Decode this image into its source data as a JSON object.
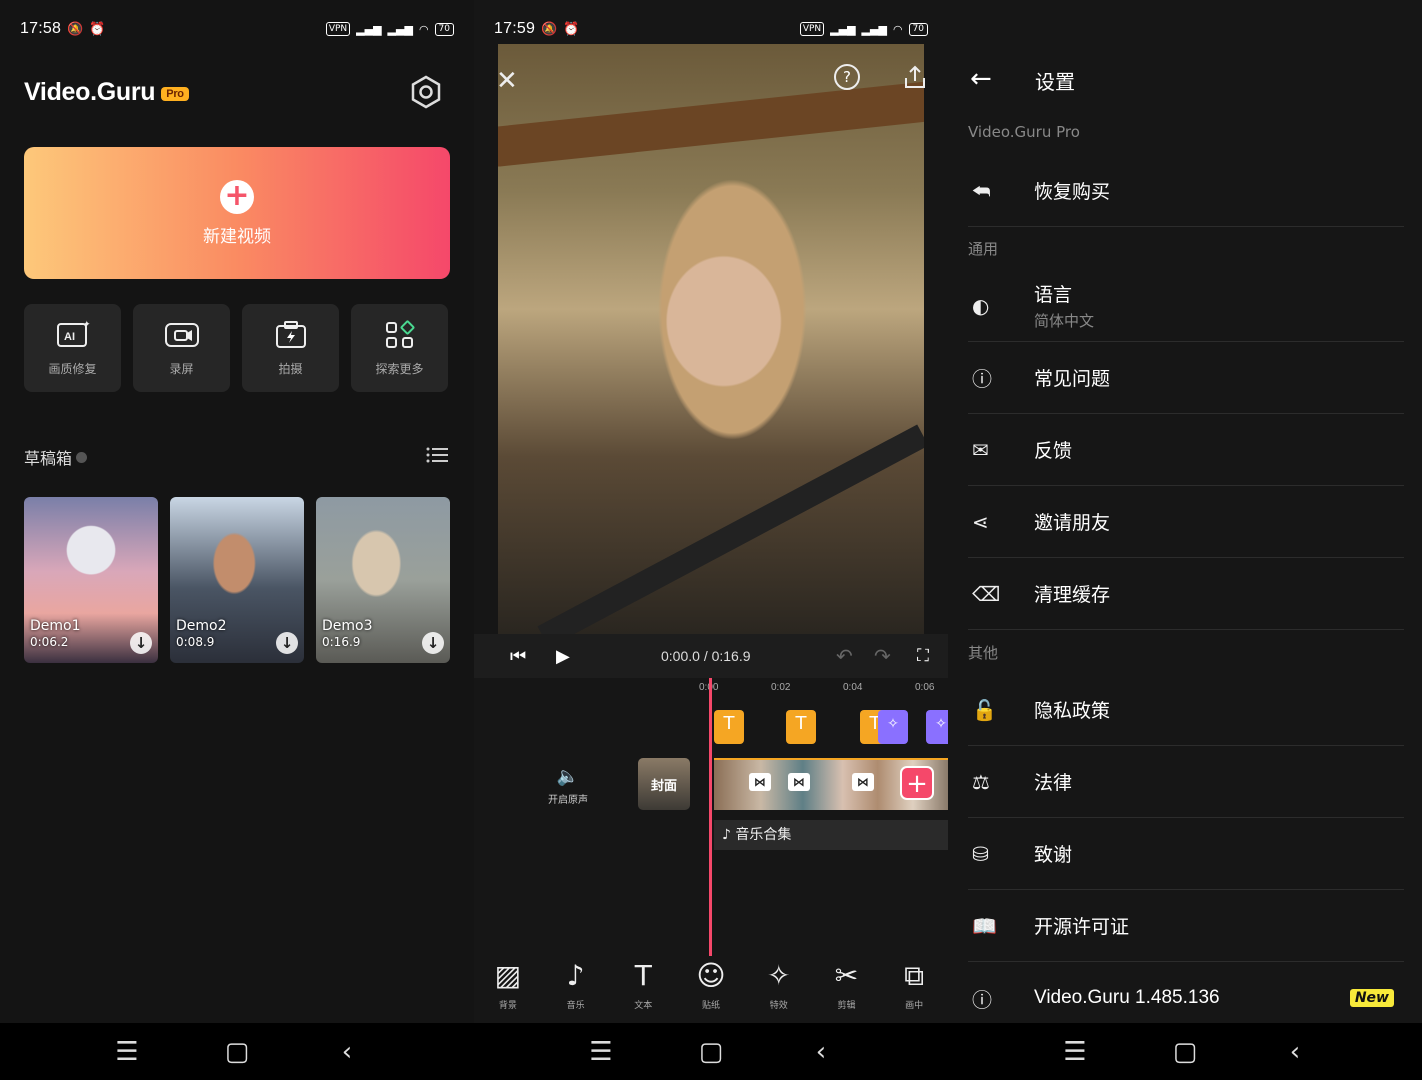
{
  "panel1": {
    "status": {
      "time": "17:58",
      "vpn": "VPN",
      "battery": "70"
    },
    "logo_text": "Video.Guru",
    "logo_badge": "Pro",
    "new_video_label": "新建视频",
    "quick_actions": [
      {
        "label": "画质修复",
        "icon": "ai-enhance-icon"
      },
      {
        "label": "录屏",
        "icon": "screen-record-icon"
      },
      {
        "label": "拍摄",
        "icon": "camera-icon"
      },
      {
        "label": "探索更多",
        "icon": "apps-grid-icon"
      }
    ],
    "drafts_title": "草稿箱",
    "drafts": [
      {
        "name": "Demo1",
        "duration": "0:06.2"
      },
      {
        "name": "Demo2",
        "duration": "0:08.9"
      },
      {
        "name": "Demo3",
        "duration": "0:16.9"
      }
    ]
  },
  "panel2": {
    "status": {
      "time": "17:59",
      "vpn": "VPN",
      "battery": "70"
    },
    "playback_time": "0:00.0 / 0:16.9",
    "ruler": [
      "0:00",
      "0:02",
      "0:04",
      "0:06"
    ],
    "orig_audio_label": "开启原声",
    "cover_label": "封面",
    "music_track_label": "音乐合集",
    "tools": [
      {
        "label": "背景",
        "icon": "background-icon"
      },
      {
        "label": "音乐",
        "icon": "music-icon"
      },
      {
        "label": "文本",
        "icon": "text-icon"
      },
      {
        "label": "贴纸",
        "icon": "sticker-icon"
      },
      {
        "label": "特效",
        "icon": "effects-icon"
      },
      {
        "label": "剪辑",
        "icon": "cut-icon"
      },
      {
        "label": "画中",
        "icon": "pip-icon"
      }
    ]
  },
  "panel3": {
    "title": "设置",
    "section_pro": "Video.Guru Pro",
    "restore_purchase": "恢复购买",
    "section_general": "通用",
    "language_label": "语言",
    "language_value": "简体中文",
    "faq": "常见问题",
    "feedback": "反馈",
    "invite": "邀请朋友",
    "clear_cache": "清理缓存",
    "section_other": "其他",
    "privacy": "隐私政策",
    "legal": "法律",
    "thanks": "致谢",
    "open_source": "开源许可证",
    "version": "Video.Guru 1.485.136",
    "new_badge": "New"
  },
  "colors": {
    "accent": "#f5486a",
    "gradient_start": "#fdc87a",
    "text_marker": "#f5a623",
    "effect_marker": "#8a70ff",
    "new_badge": "#f7e93a"
  }
}
